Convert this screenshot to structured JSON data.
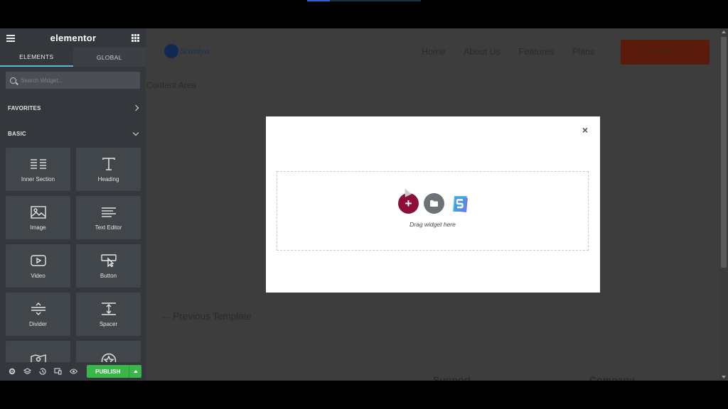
{
  "sidebar": {
    "logo": "elementor",
    "tabs": [
      {
        "label": "ELEMENTS",
        "active": true
      },
      {
        "label": "GLOBAL",
        "active": false
      }
    ],
    "search": {
      "placeholder": "Search Widget..."
    },
    "sections": {
      "favorites": "FAVORITES",
      "basic": "BASIC"
    },
    "widgets": [
      {
        "label": "Inner Section",
        "icon": "inner-section-icon"
      },
      {
        "label": "Heading",
        "icon": "heading-icon"
      },
      {
        "label": "Image",
        "icon": "image-icon"
      },
      {
        "label": "Text Editor",
        "icon": "text-editor-icon"
      },
      {
        "label": "Video",
        "icon": "video-icon"
      },
      {
        "label": "Button",
        "icon": "button-icon"
      },
      {
        "label": "Divider",
        "icon": "divider-icon"
      },
      {
        "label": "Spacer",
        "icon": "spacer-icon"
      }
    ],
    "footer": {
      "publish_label": "PUBLISH"
    }
  },
  "site": {
    "logo_text": "Scaniya",
    "nav": [
      "Home",
      "About Us",
      "Features",
      "Plans"
    ],
    "cta": "Download App",
    "content_area_label": "Content Area",
    "previous_template": "← Previous Template",
    "footer_support": "Support",
    "footer_company": "Company"
  },
  "modal": {
    "close_glyph": "×",
    "add_glyph": "+",
    "dropzone_label": "Drag widget here"
  },
  "colors": {
    "sidebar_bg": "#34383c",
    "publish_green": "#39b54a",
    "add_section_maroon": "#8d0d3b",
    "tab_active_underline": "#58b7d3"
  }
}
